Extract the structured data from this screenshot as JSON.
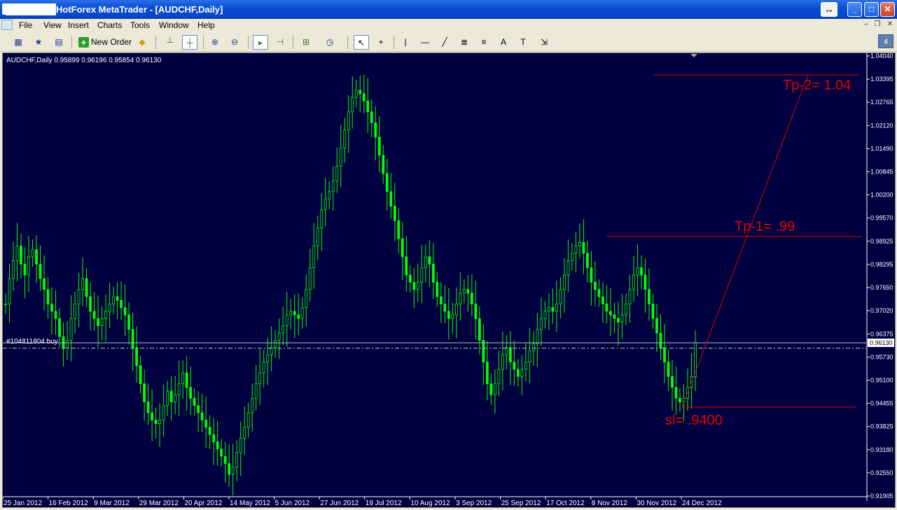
{
  "window": {
    "title": "HotForex MetaTrader - [AUDCHF,Daily]"
  },
  "menu": {
    "items": [
      {
        "key": "file",
        "label": "File",
        "underline": "F"
      },
      {
        "key": "view",
        "label": "View",
        "underline": "V"
      },
      {
        "key": "insert",
        "label": "Insert",
        "underline": "I"
      },
      {
        "key": "charts",
        "label": "Charts",
        "underline": "C"
      },
      {
        "key": "tools",
        "label": "Tools",
        "underline": "T"
      },
      {
        "key": "window",
        "label": "Window",
        "underline": "W"
      },
      {
        "key": "help",
        "label": "Help",
        "underline": "H"
      }
    ]
  },
  "toolbar": {
    "new_order_label": "New Order",
    "tab_count": "4"
  },
  "chart": {
    "symbol_info": "AUDCHF,Daily  0.95899 0.96196 0.95854 0.96130",
    "order_label": "#104811804 buy",
    "current_price_label": "0.96130",
    "colors": {
      "background": "#000040",
      "candles": "#00ff00",
      "annotation": "#e00000",
      "axis": "#ffffff",
      "order_line": "#808080",
      "price_line": "#c0c0c0"
    },
    "annotations": [
      {
        "text": "Tp-2= 1.04",
        "price": 1.034
      },
      {
        "text": "Tp-1= .99",
        "price": 0.989
      },
      {
        "text": "sl= .9400",
        "price": 0.9443
      }
    ],
    "price_ticks": [
      "1.04040",
      "1.03395",
      "1.02765",
      "1.02120",
      "1.01490",
      "1.00845",
      "1.00200",
      "0.99570",
      "0.98925",
      "0.98295",
      "0.97650",
      "0.97020",
      "0.96375",
      "0.95730",
      "0.95100",
      "0.94455",
      "0.93825",
      "0.93180",
      "0.92550",
      "0.91905"
    ],
    "date_ticks": [
      "25 Jan 2012",
      "16 Feb 2012",
      "9 Mar 2012",
      "29 Mar 2012",
      "20 Apr 2012",
      "14 May 2012",
      "5 Jun 2012",
      "27 Jun 2012",
      "19 Jul 2012",
      "10 Aug 2012",
      "3 Sep 2012",
      "25 Sep 2012",
      "17 Oct 2012",
      "8 Nov 2012",
      "30 Nov 2012",
      "24 Dec 2012"
    ],
    "price_series": [
      0.972,
      0.979,
      0.984,
      0.988,
      0.983,
      0.98,
      0.985,
      0.987,
      0.983,
      0.979,
      0.976,
      0.972,
      0.97,
      0.968,
      0.963,
      0.96,
      0.962,
      0.968,
      0.972,
      0.976,
      0.979,
      0.974,
      0.97,
      0.968,
      0.966,
      0.968,
      0.97,
      0.972,
      0.974,
      0.973,
      0.971,
      0.969,
      0.965,
      0.96,
      0.955,
      0.95,
      0.945,
      0.942,
      0.94,
      0.939,
      0.94,
      0.944,
      0.948,
      0.945,
      0.947,
      0.95,
      0.953,
      0.949,
      0.946,
      0.944,
      0.942,
      0.94,
      0.938,
      0.936,
      0.934,
      0.932,
      0.93,
      0.928,
      0.925,
      0.927,
      0.931,
      0.935,
      0.938,
      0.942,
      0.946,
      0.95,
      0.953,
      0.956,
      0.958,
      0.96,
      0.962,
      0.964,
      0.966,
      0.969,
      0.97,
      0.969,
      0.968,
      0.971,
      0.976,
      0.982,
      0.988,
      0.993,
      0.998,
      1.001,
      1.003,
      1.006,
      1.01,
      1.015,
      1.02,
      1.025,
      1.029,
      1.031,
      1.03,
      1.028,
      1.025,
      1.022,
      1.018,
      1.013,
      1.008,
      1.003,
      0.999,
      0.995,
      0.99,
      0.985,
      0.98,
      0.978,
      0.976,
      0.978,
      0.982,
      0.985,
      0.983,
      0.978,
      0.974,
      0.972,
      0.97,
      0.968,
      0.969,
      0.972,
      0.975,
      0.976,
      0.975,
      0.972,
      0.968,
      0.962,
      0.956,
      0.95,
      0.947,
      0.95,
      0.954,
      0.958,
      0.96,
      0.956,
      0.954,
      0.952,
      0.954,
      0.956,
      0.959,
      0.961,
      0.965,
      0.968,
      0.97,
      0.971,
      0.97,
      0.972,
      0.976,
      0.98,
      0.984,
      0.986,
      0.988,
      0.989,
      0.986,
      0.982,
      0.978,
      0.976,
      0.974,
      0.972,
      0.97,
      0.969,
      0.968,
      0.967,
      0.969,
      0.972,
      0.976,
      0.98,
      0.982,
      0.98,
      0.976,
      0.972,
      0.968,
      0.964,
      0.96,
      0.956,
      0.952,
      0.949,
      0.946,
      0.945,
      0.946,
      0.949,
      0.952,
      0.9613
    ]
  }
}
